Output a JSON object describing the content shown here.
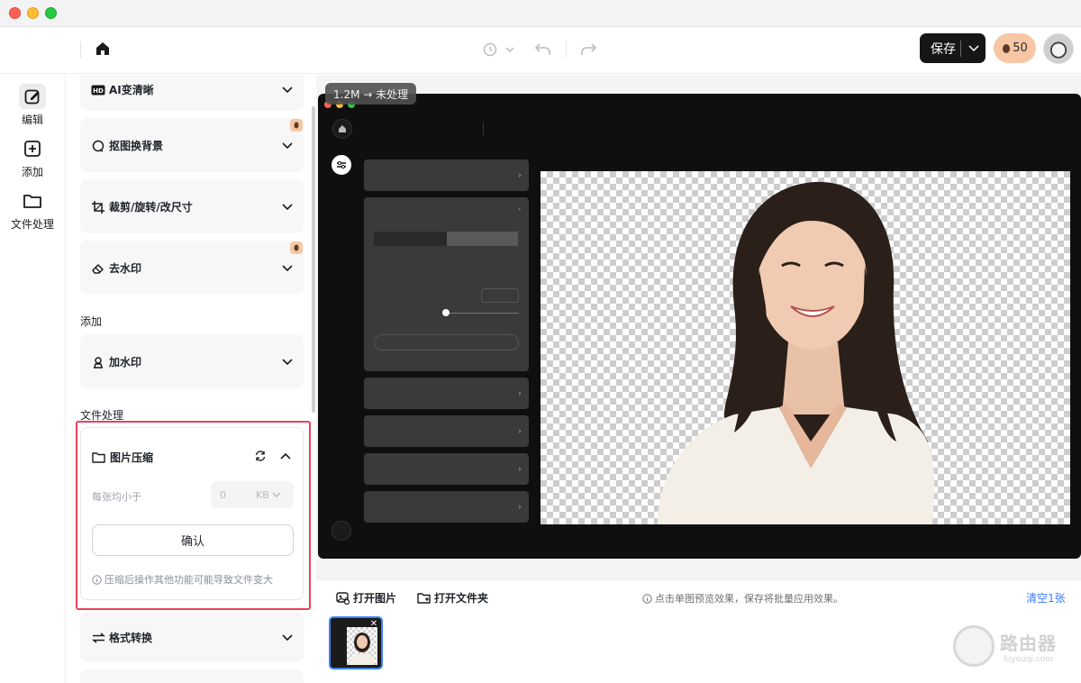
{
  "toolbar": {
    "save_label": "保存",
    "credits": "50"
  },
  "rail": {
    "items": [
      {
        "label": "编辑",
        "icon": "edit-icon"
      },
      {
        "label": "添加",
        "icon": "add-icon"
      },
      {
        "label": "文件处理",
        "icon": "folder-icon"
      }
    ]
  },
  "panel": {
    "tools": [
      {
        "label": "AI变清晰",
        "icon": "hd-icon"
      },
      {
        "label": "抠图换背景",
        "icon": "cutout-icon",
        "premium": true
      },
      {
        "label": "裁剪/旋转/改尺寸",
        "icon": "crop-icon"
      },
      {
        "label": "去水印",
        "icon": "eraser-icon",
        "premium": true
      }
    ],
    "section_add": "添加",
    "add_tools": [
      {
        "label": "加水印",
        "icon": "stamp-icon"
      }
    ],
    "section_file": "文件处理",
    "compress": {
      "title": "图片压缩",
      "size_label": "每张均小于",
      "size_value": "0",
      "unit": "KB",
      "confirm": "确认",
      "note": "压缩后操作其他功能可能导致文件变大"
    },
    "format_convert": "格式转换"
  },
  "preview": {
    "size_badge": "1.2M → 未处理"
  },
  "bottom": {
    "open_image": "打开图片",
    "open_folder": "打开文件夹",
    "hint": "点击单图预览效果，保存将批量应用效果。",
    "clear": "清空1张"
  },
  "watermark": {
    "text": "路由器",
    "sub": "luyouqi.com"
  },
  "colors": {
    "accent": "#3a7cff",
    "highlight": "#e8405a",
    "save_bg": "#161616",
    "credit_bg": "#f7c7a5"
  }
}
